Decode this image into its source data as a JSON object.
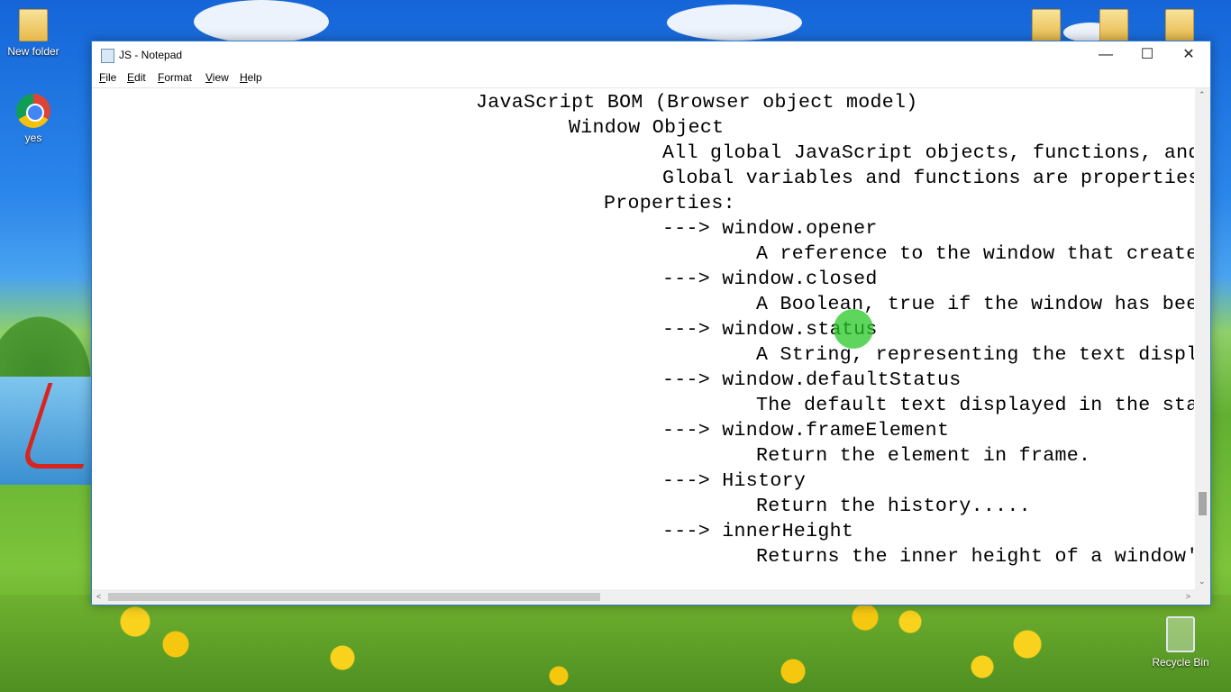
{
  "desktop": {
    "icons": [
      {
        "name": "new-folder",
        "label": "New folder"
      },
      {
        "name": "chrome-shortcut",
        "label": "yes"
      },
      {
        "name": "recycle-bin",
        "label": "Recycle Bin"
      }
    ]
  },
  "window": {
    "title": "JS - Notepad",
    "controls": {
      "minimize": "—",
      "maximize": "☐",
      "close": "✕"
    },
    "menu": [
      "File",
      "Edit",
      "Format",
      "View",
      "Help"
    ]
  },
  "editor": {
    "lines": [
      "JavaScript BOM (Browser object model)",
      "Window Object",
      "All global JavaScript objects, functions, and",
      "Global variables and functions are properties",
      "Properties:",
      "---> window.opener",
      "A reference to the window that create",
      "---> window.closed",
      "A Boolean, true if the window has bee",
      "---> window.status",
      "A String, representing the text displ",
      "---> window.defaultStatus",
      "The default text displayed in the sta",
      "---> window.frameElement",
      "Return the element in frame.",
      "---> History",
      "Return the history.....",
      "---> innerHeight",
      "Returns the inner height of a window'"
    ]
  },
  "scrollbars": {
    "up": "⌃",
    "down": "⌄",
    "left": "<",
    "right": ">"
  }
}
